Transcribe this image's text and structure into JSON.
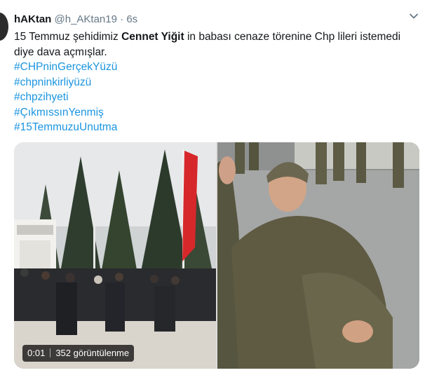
{
  "author": {
    "display_name": "hAKtan",
    "handle": "@h_AKtan19",
    "separator": "·",
    "time": "6s"
  },
  "tweet": {
    "text_before": "15 Temmuz şehidimiz ",
    "text_bold": "Cennet Yiğit",
    "text_after": " in babası cenaze törenine Chp lileri istemedi diye dava açmışlar.",
    "hashtags": [
      "#CHPninGerçekYüzü",
      "#chpninkirliyüzü",
      "#chpzihyeti",
      "#ÇıkmıssınYenmiş",
      "#15TemmuzuUnutma"
    ]
  },
  "media": {
    "video_time": "0:01",
    "views": "352 görüntülenme"
  },
  "icons": {
    "menu": "chevron-down-icon"
  },
  "colors": {
    "link": "#1b95e0",
    "secondary_text": "#657786"
  }
}
